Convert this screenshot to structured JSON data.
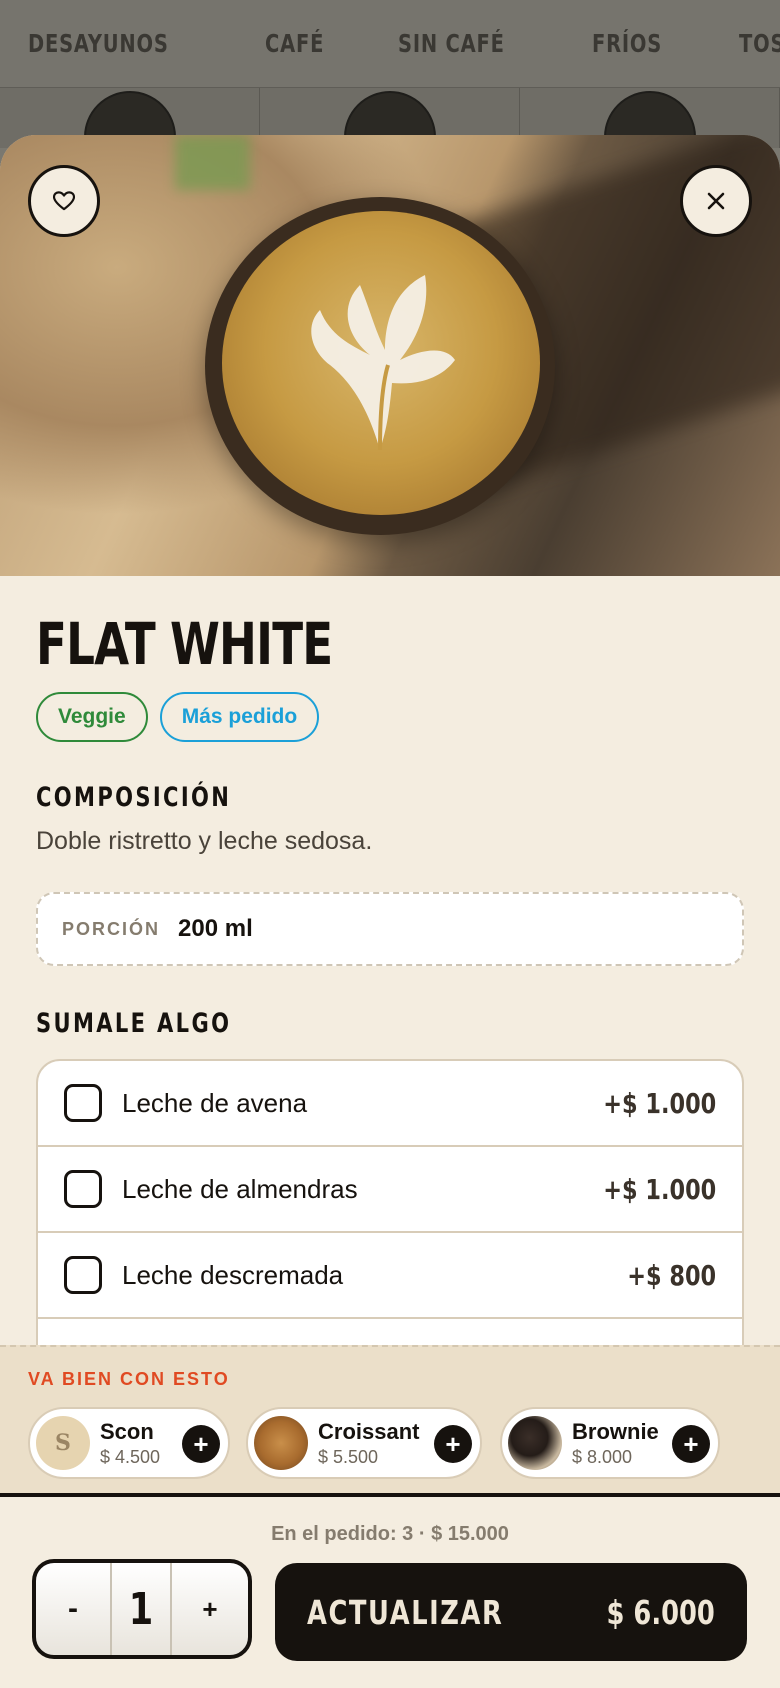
{
  "categories": [
    "DESAYUNOS",
    "CAFÉ",
    "SIN CAFÉ",
    "FRÍOS",
    "TOSTADAS Y SÁNDU"
  ],
  "product": {
    "name": "FLAT WHITE",
    "tags": [
      "Veggie",
      "Más pedido"
    ],
    "composition_heading": "COMPOSICIÓN",
    "description": "Doble ristretto y leche sedosa.",
    "portion_label": "PORCIÓN",
    "portion_value": "200 ml"
  },
  "extras": {
    "heading": "SUMALE ALGO",
    "items": [
      {
        "name": "Leche de avena",
        "price": "+$ 1.000",
        "checked": false
      },
      {
        "name": "Leche de almendras",
        "price": "+$ 1.000",
        "checked": false
      },
      {
        "name": "Leche descremada",
        "price": "+$ 800",
        "checked": false
      }
    ]
  },
  "pairing": {
    "heading": "VA BIEN CON ESTO",
    "items": [
      {
        "name": "Scon",
        "price": "$ 4.500",
        "initial": "S"
      },
      {
        "name": "Croissant",
        "price": "$ 5.500"
      },
      {
        "name": "Brownie",
        "price": "$ 8.000"
      }
    ]
  },
  "footer": {
    "order_summary": "En el pedido: 3 · $ 15.000",
    "minus": "-",
    "quantity": "1",
    "plus": "+",
    "cta_label": "ACTUALIZAR",
    "cta_price": "$ 6.000"
  },
  "icons": {
    "favorite": "heart-icon",
    "close": "close-icon",
    "add": "plus-icon"
  },
  "colors": {
    "accent_red": "#e04a22",
    "veggie_green": "#2f8a3a",
    "popular_blue": "#1ba0d8",
    "ink": "#16120e",
    "cream": "#f4ede0"
  }
}
